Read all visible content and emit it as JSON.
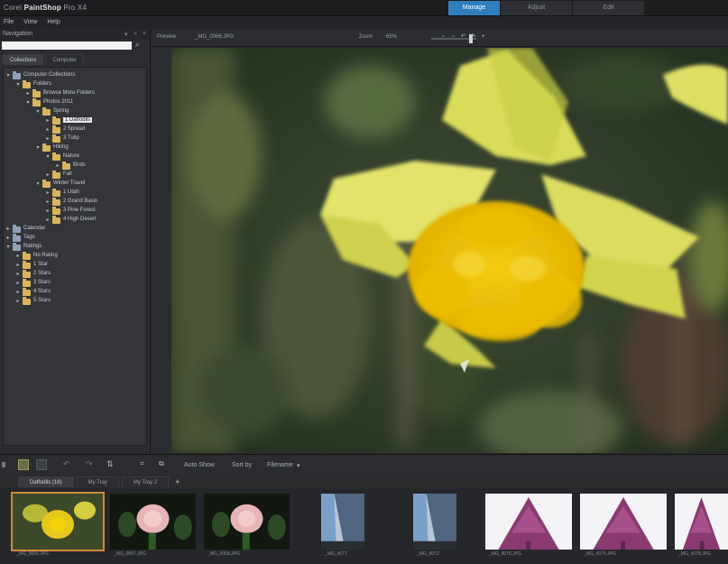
{
  "app": {
    "title_prefix": "Corel",
    "title_brand": "PaintShop",
    "title_suffix": "Pro X4"
  },
  "mode_tabs": [
    {
      "label": "Manage",
      "active": true
    },
    {
      "label": "Adjust",
      "active": false
    },
    {
      "label": "Edit",
      "active": false
    }
  ],
  "menu": [
    "File",
    "View",
    "Help"
  ],
  "navigation": {
    "title": "Navigation",
    "search_placeholder": "",
    "tabs": [
      {
        "label": "Collections",
        "active": true
      },
      {
        "label": "Computer",
        "active": false
      }
    ],
    "tree": [
      {
        "label": "Computer Collections",
        "depth": 0,
        "expanded": true,
        "type": "pc"
      },
      {
        "label": "Folders",
        "depth": 1,
        "expanded": true
      },
      {
        "label": "Browse More Folders",
        "depth": 2,
        "expanded": false
      },
      {
        "label": "Photos 2011",
        "depth": 2,
        "expanded": true
      },
      {
        "label": "Spring",
        "depth": 3,
        "expanded": true
      },
      {
        "label": "1 Daffodils",
        "depth": 4,
        "expanded": false,
        "selected": true
      },
      {
        "label": "2 Spread",
        "depth": 4,
        "expanded": false
      },
      {
        "label": "3 Tulip",
        "depth": 4,
        "expanded": false
      },
      {
        "label": "Hiking",
        "depth": 3,
        "expanded": true
      },
      {
        "label": "Nature",
        "depth": 4,
        "expanded": true
      },
      {
        "label": "Birds",
        "depth": 5,
        "expanded": false
      },
      {
        "label": "Fall",
        "depth": 4,
        "expanded": false
      },
      {
        "label": "Winter Travel",
        "depth": 3,
        "expanded": true
      },
      {
        "label": "1 Utah",
        "depth": 4,
        "expanded": false
      },
      {
        "label": "2 Grand Basin",
        "depth": 4,
        "expanded": false
      },
      {
        "label": "3 Pine Forest",
        "depth": 4,
        "expanded": false
      },
      {
        "label": "4 High Desert",
        "depth": 4,
        "expanded": false
      },
      {
        "label": "Calendar",
        "depth": 0,
        "expanded": false,
        "type": "pc"
      },
      {
        "label": "Tags",
        "depth": 0,
        "expanded": false,
        "type": "pc"
      },
      {
        "label": "Ratings",
        "depth": 0,
        "expanded": true,
        "type": "pc"
      },
      {
        "label": "No Rating",
        "depth": 1,
        "expanded": false
      },
      {
        "label": "1 Star",
        "depth": 1,
        "expanded": false
      },
      {
        "label": "2 Stars",
        "depth": 1,
        "expanded": false
      },
      {
        "label": "3 Stars",
        "depth": 1,
        "expanded": false
      },
      {
        "label": "4 Stars",
        "depth": 1,
        "expanded": false
      },
      {
        "label": "5 Stars",
        "depth": 1,
        "expanded": false
      }
    ]
  },
  "infobar": {
    "preview_label": "Preview",
    "file_label": "_MG_0066.JPG",
    "zoom_label": "Zoom",
    "zoom_value": "65%"
  },
  "organizer": {
    "toolbar": {
      "view_label": "Auto Show",
      "sort_label": "Sort by",
      "filter_label": "Filename"
    },
    "tabs": [
      {
        "label": "Daffodils (16)",
        "active": true
      },
      {
        "label": "My Tray",
        "active": false
      },
      {
        "label": "My Tray 2",
        "active": false
      }
    ],
    "thumbnails": [
      {
        "caption": "_MG_0066.JPG",
        "kind": "daffodil"
      },
      {
        "caption": "_MG_0067.JPG",
        "kind": "rose"
      },
      {
        "caption": "_MG_0068.JPG",
        "kind": "rose"
      },
      {
        "caption": "_MG_4071",
        "kind": "building"
      },
      {
        "caption": "_MG_4072",
        "kind": "building"
      },
      {
        "caption": "_MG_4075.JPG",
        "kind": "tree"
      },
      {
        "caption": "_MG_4076.JPG",
        "kind": "tree"
      },
      {
        "caption": "_MG_4078.JPG",
        "kind": "tree"
      }
    ]
  },
  "colors": {
    "accent": "#2f7fbf",
    "selection": "#d08a3a",
    "folder": "#d9b65a"
  }
}
